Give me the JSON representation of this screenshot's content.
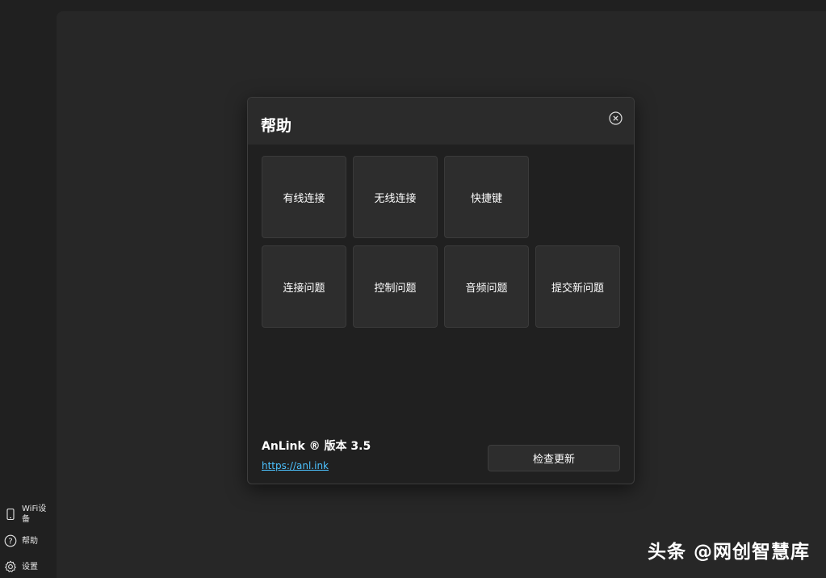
{
  "sidebar": {
    "items": [
      {
        "label": "WiFi设备",
        "icon": "phone-icon"
      },
      {
        "label": "帮助",
        "icon": "help-circle-icon"
      },
      {
        "label": "设置",
        "icon": "gear-icon"
      }
    ]
  },
  "dialog": {
    "title": "帮助",
    "close_icon": "close-circle-icon",
    "tiles": [
      {
        "label": "有线连接"
      },
      {
        "label": "无线连接"
      },
      {
        "label": "快捷键"
      },
      {
        "label": "连接问题"
      },
      {
        "label": "控制问题"
      },
      {
        "label": "音频问题"
      },
      {
        "label": "提交新问题"
      }
    ],
    "version": "AnLink ® 版本 3.5",
    "link": "https://anl.ink",
    "update_button": "检查更新"
  },
  "watermark": "头条 @网创智慧库",
  "colors": {
    "background": "#202020",
    "panel": "#272727",
    "tile": "#2d2d2d",
    "link": "#4cc2ff"
  }
}
